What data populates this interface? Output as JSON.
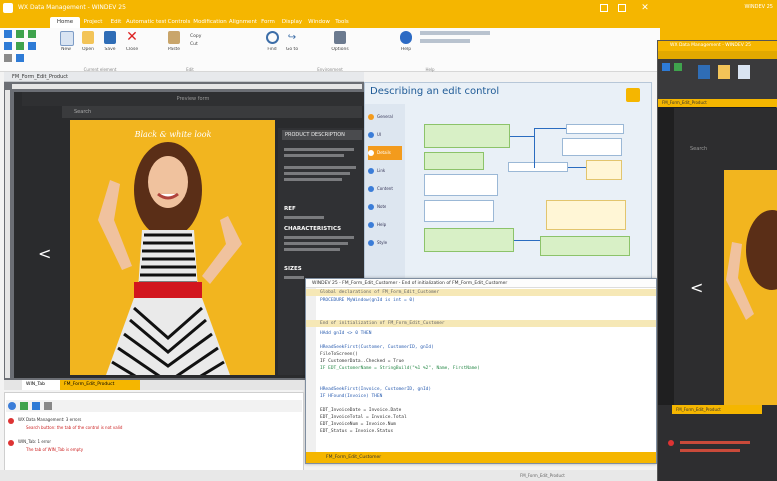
{
  "main_window": {
    "title": "WX Data Management - WINDEV 25",
    "tabs": [
      "Home",
      "Project",
      "Edit",
      "Automatic tests",
      "Controls",
      "Modification",
      "Alignment",
      "Form",
      "Display",
      "Window",
      "Tools"
    ],
    "active_tab": "Home",
    "ribbon": {
      "buttons": [
        "New",
        "Open",
        "Save",
        "Close",
        "Paste",
        "Copy",
        "Cut",
        "Find",
        "Go to",
        "Options",
        "Help"
      ],
      "groups": [
        "Current element",
        "Edit",
        "Environment",
        "Help"
      ]
    },
    "editor_tab": "FM_Form_Edit_Product"
  },
  "form_preview": {
    "header": "Preview form",
    "search_placeholder": "Search",
    "photo_title": "Black & white look",
    "prev_arrow": "<",
    "description": {
      "header": "PRODUCT DESCRIPTION",
      "sections": [
        "REF",
        "CHARACTERISTICS",
        "SIZES"
      ]
    }
  },
  "help_panel": {
    "title": "Describing an edit control",
    "sidebar_items": [
      "General",
      "UI",
      "Details",
      "Link",
      "Content",
      "Note",
      "Help",
      "Style"
    ]
  },
  "code_window": {
    "title": "WINDEV 25 - FM_Form_Edit_Customer - End of initialization of FM_Form_Edit_Customer",
    "lines": [
      "Global declarations of FM_Form_Edit_Customer",
      "PROCEDURE MyWindow(gnId is int = 0)",
      "",
      "End of initialization of FM_Form_Edit_Customer",
      "HAdd gnId <> 0 THEN",
      "",
      "  HReadSeekFirst(Customer, CustomerID, gnId)",
      "  FileToScreen()",
      "  IF CustomerData..Checked = True",
      "  IF EDT_CustomerName = StringBuild(\"%1 %2\", Name, FirstName)",
      "",
      "  HReadSeekFirst(Invoice, CustomerID, gnId)",
      "  IF HFound(Invoice) THEN",
      "",
      "    EDT_InvoiceDate = Invoice.Date",
      "    EDT_InvoiceTotal = Invoice.Total",
      "    EDT_InvoiceNum = Invoice.Num",
      "    EDT_Status = Invoice.Status"
    ],
    "bottom_tab": "FM_Form_Edit_Customer"
  },
  "doc_tabs": [
    "WIN_Tab",
    "FM_Form_Edit_Product"
  ],
  "errors_panel": {
    "rows": [
      "WX Data Management: 3 errors",
      "Search button: the tab of the control is not valid",
      "WIN_Tab: 1 error",
      "The tab of WIN_Tab is empty"
    ]
  },
  "status_bar": {
    "text": "FM_Form_Edit_Product"
  },
  "second_window": {
    "title": "WX Data Management - WINDEV 25",
    "editor_tab": "FM_Form_Edit_Product",
    "search_placeholder": "Search",
    "prev_arrow": "<",
    "bottom_tab": "FM_Form_Edit_Product"
  },
  "brand": {
    "text": "WINDEV 25"
  },
  "colors": {
    "accent": "#f5b600",
    "photo_bg": "#f2b51f",
    "help_title": "#1e5a96"
  }
}
